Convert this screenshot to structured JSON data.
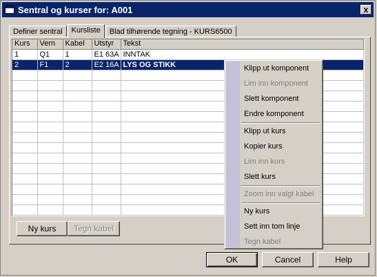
{
  "window": {
    "title": "Sentral og kurser for: A001",
    "close_label": "x"
  },
  "tabs": [
    {
      "label": "Definer sentral",
      "active": false
    },
    {
      "label": "Kursliste",
      "active": true
    },
    {
      "label": "Blad tilhørende tegning - KURS6500",
      "active": false
    }
  ],
  "table": {
    "columns": [
      "Kurs",
      "Vern",
      "Kabel",
      "Utstyr",
      "Tekst"
    ],
    "rows": [
      [
        "1",
        "Q1",
        "1",
        "E1 63A",
        "INNTAK"
      ],
      [
        "2",
        "F1",
        "2",
        "E2 16A",
        "LYS OG STIKK"
      ]
    ],
    "selected_row": 1
  },
  "panel_buttons": {
    "ny_kurs": "Ny kurs",
    "tegn_kabel": "Tegn kabel"
  },
  "dialog_buttons": {
    "ok": "OK",
    "cancel": "Cancel",
    "help": "Help"
  },
  "context_menu": {
    "stripe_color": "#c3c1d8",
    "items": [
      {
        "label": "Klipp ut komponent",
        "enabled": true
      },
      {
        "label": "Lim inn komponent",
        "enabled": false
      },
      {
        "label": "Slett komponent",
        "enabled": true
      },
      {
        "label": "Endre komponent",
        "enabled": true
      },
      {
        "label": "Klipp ut kurs",
        "enabled": true
      },
      {
        "label": "Kopier kurs",
        "enabled": true
      },
      {
        "label": "Lim inn kurs",
        "enabled": false
      },
      {
        "label": "Slett kurs",
        "enabled": true
      },
      {
        "label": "Zoom inn valgt kabel",
        "enabled": false
      },
      {
        "label": "Ny kurs",
        "enabled": true
      },
      {
        "label": "Sett inn tom linje",
        "enabled": true
      },
      {
        "label": "Tegn kabel",
        "enabled": false
      }
    ]
  },
  "colors": {
    "titlebar": "#0a246a",
    "selection": "#0a246a",
    "face": "#d4d0c8"
  }
}
